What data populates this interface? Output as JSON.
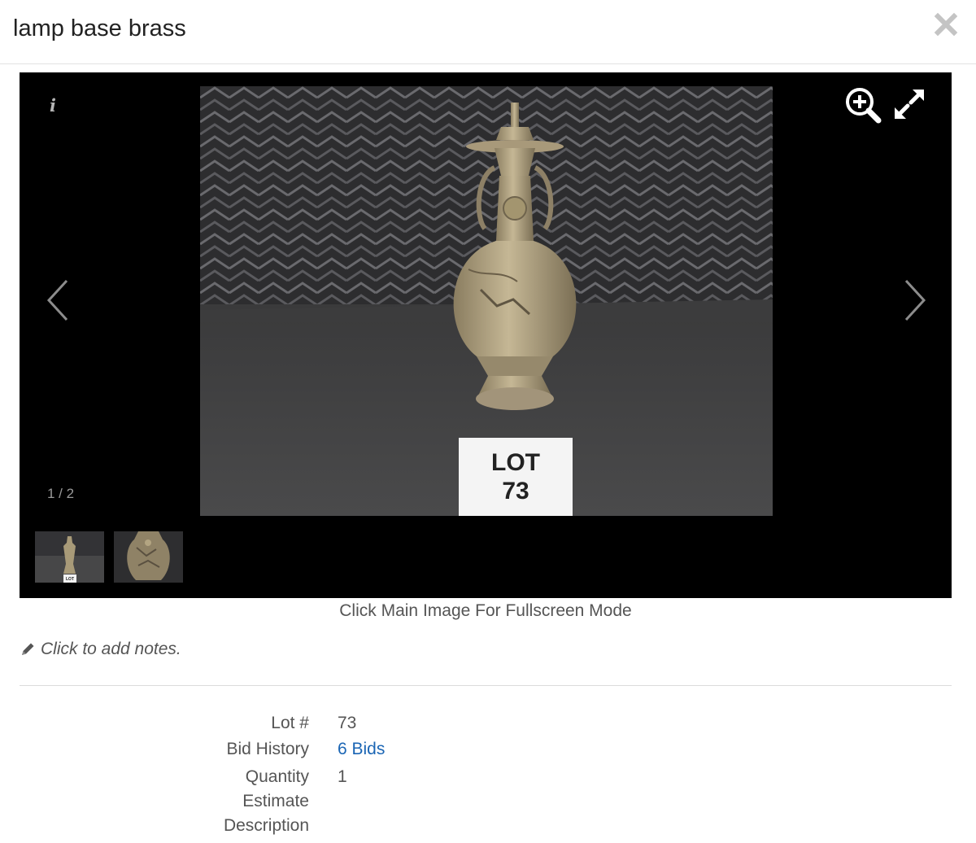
{
  "modal": {
    "title": "lamp base brass"
  },
  "viewer": {
    "info_label": "i",
    "counter": "1 / 2",
    "main_image_sign_line1": "LOT",
    "main_image_sign_line2": "73",
    "thumb_sign": "LOT",
    "caption": "Click Main Image For Fullscreen Mode"
  },
  "notes": {
    "label": "Click to add notes."
  },
  "details": {
    "lot_label": "Lot #",
    "lot_value": "73",
    "bids_label": "Bid History",
    "bids_value": "6 Bids",
    "quantity_label": "Quantity",
    "quantity_value": "1",
    "estimate_label": "Estimate",
    "estimate_value": "",
    "description_label": "Description",
    "description_value": ""
  },
  "colors": {
    "viewer_bg": "#000000",
    "link": "#1a65b4",
    "divider": "#dcdcdc"
  }
}
